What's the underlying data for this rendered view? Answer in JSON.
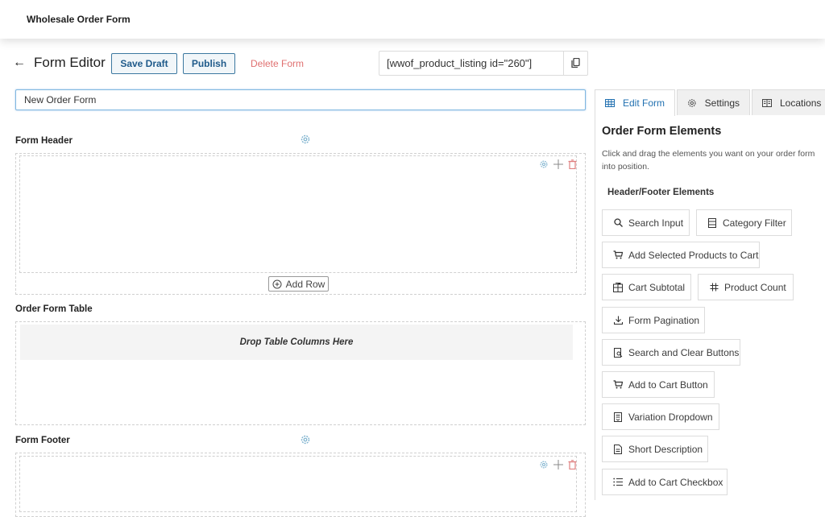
{
  "app": {
    "title": "Wholesale Order Form"
  },
  "toolbar": {
    "page_title": "Form Editor",
    "save_draft_label": "Save Draft",
    "publish_label": "Publish",
    "delete_label": "Delete Form",
    "shortcode": "[wwof_product_listing id=\"260\"]"
  },
  "form": {
    "name_value": "New Order Form",
    "sections": {
      "header_label": "Form Header",
      "add_row_label": "Add Row",
      "table_label": "Order Form Table",
      "drop_label": "Drop Table Columns Here",
      "footer_label": "Form Footer"
    }
  },
  "sidebar": {
    "tabs": [
      {
        "label": "Edit Form",
        "icon": "table-icon",
        "active": true
      },
      {
        "label": "Settings",
        "icon": "gear-icon",
        "active": false
      },
      {
        "label": "Locations",
        "icon": "book-icon",
        "active": false
      }
    ],
    "title": "Order Form Elements",
    "description": "Click and drag the elements you want on your order form into position.",
    "subheading": "Header/Footer Elements",
    "elements": [
      {
        "label": "Search Input",
        "icon": "search-icon"
      },
      {
        "label": "Category Filter",
        "icon": "list-box-icon"
      },
      {
        "label": "Add Selected Products to Cart",
        "icon": "cart-icon"
      },
      {
        "label": "Cart Subtotal",
        "icon": "calculator-icon"
      },
      {
        "label": "Product Count",
        "icon": "hash-icon"
      },
      {
        "label": "Form Pagination",
        "icon": "download-icon"
      },
      {
        "label": "Search and Clear Buttons",
        "icon": "search-doc-icon"
      },
      {
        "label": "Add to Cart Button",
        "icon": "cart-icon"
      },
      {
        "label": "Variation Dropdown",
        "icon": "dropdown-doc-icon"
      },
      {
        "label": "Short Description",
        "icon": "document-icon"
      },
      {
        "label": "Add to Cart Checkbox",
        "icon": "checklist-icon"
      }
    ]
  },
  "colors": {
    "accent": "#2271b1",
    "button_border": "#3c78a0",
    "delete": "#e07070",
    "gear": "#7fb3cf",
    "trash": "#e08080"
  }
}
